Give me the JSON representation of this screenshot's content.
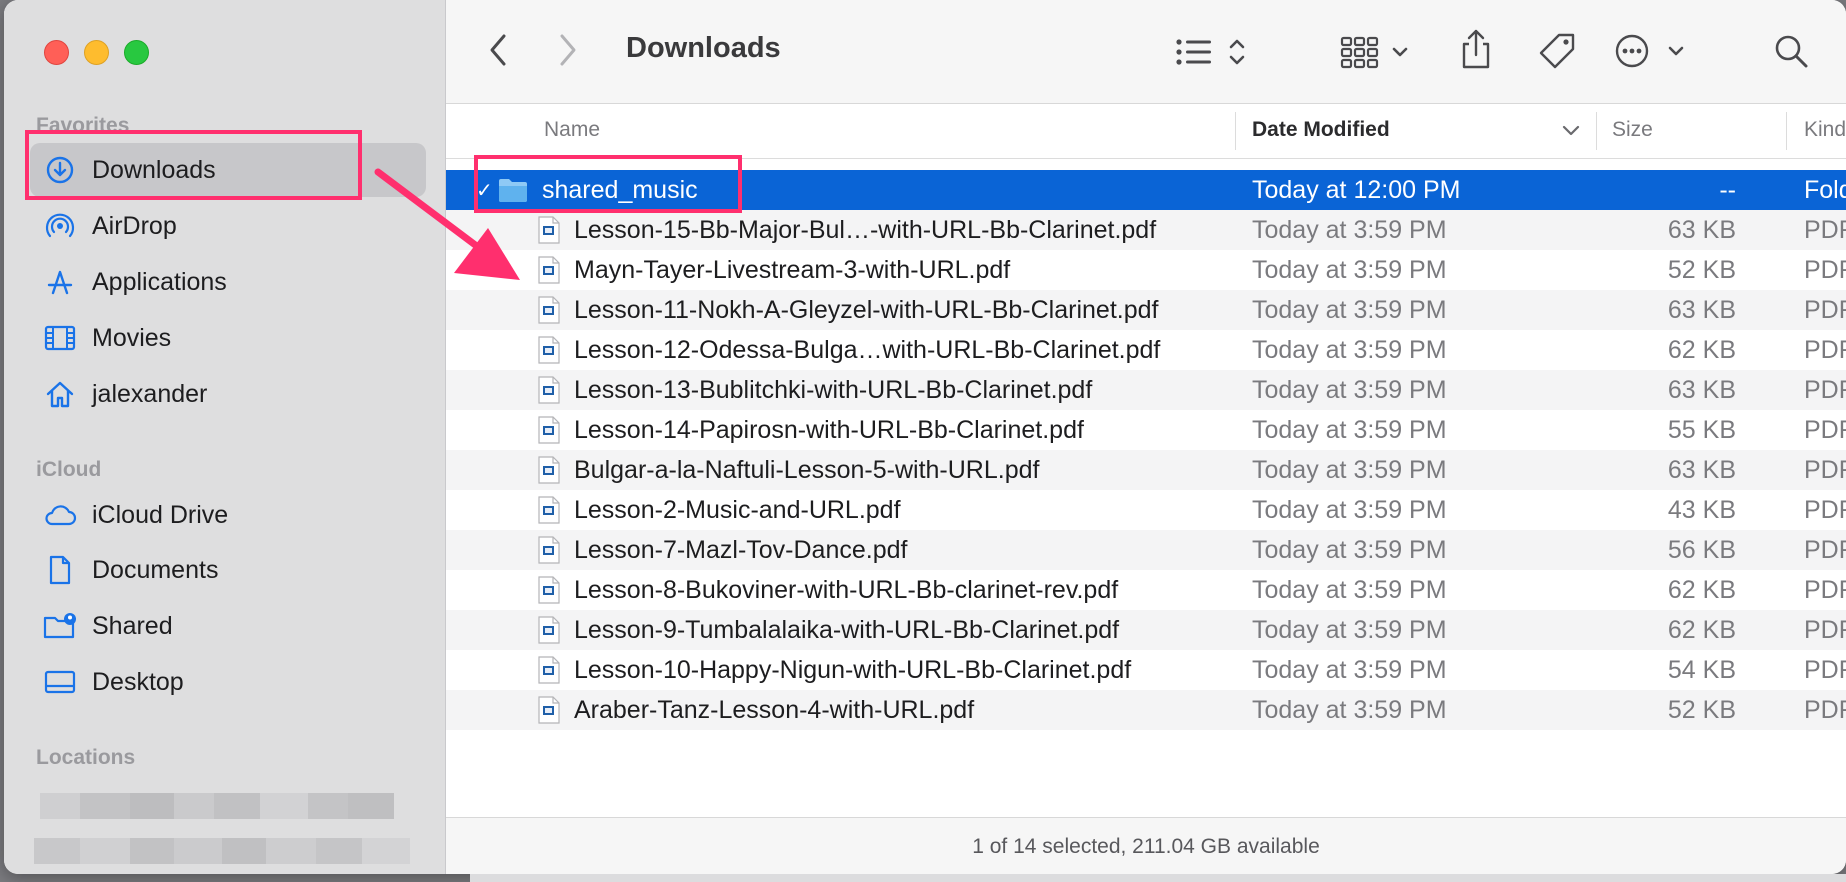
{
  "window": {
    "title": "Downloads"
  },
  "sidebar": {
    "sections": {
      "favorites": "Favorites",
      "icloud": "iCloud",
      "locations": "Locations"
    },
    "favorites": [
      {
        "label": "Downloads",
        "icon": "download-circle-icon"
      },
      {
        "label": "AirDrop",
        "icon": "airdrop-icon"
      },
      {
        "label": "Applications",
        "icon": "applications-icon"
      },
      {
        "label": "Movies",
        "icon": "film-icon"
      },
      {
        "label": "jalexander",
        "icon": "home-icon"
      }
    ],
    "icloud": [
      {
        "label": "iCloud Drive",
        "icon": "cloud-icon"
      },
      {
        "label": "Documents",
        "icon": "document-icon"
      },
      {
        "label": "Shared",
        "icon": "shared-folder-icon"
      },
      {
        "label": "Desktop",
        "icon": "desktop-icon"
      }
    ],
    "selected": "Downloads"
  },
  "toolbar": {
    "back": "back-chevron-icon",
    "forward": "forward-chevron-icon",
    "view_list": "list-view-icon",
    "group": "group-grid-icon",
    "share": "share-icon",
    "tags": "tag-icon",
    "more": "ellipsis-circle-icon",
    "search": "search-icon"
  },
  "columns": {
    "name": "Name",
    "date": "Date Modified",
    "size": "Size",
    "kind": "Kind"
  },
  "rows": [
    {
      "name": "shared_music",
      "date": "Today at 12:00 PM",
      "size": "--",
      "kind": "Folder",
      "type": "folder",
      "selected": true
    },
    {
      "name": "Lesson-15-Bb-Major-Bul…-with-URL-Bb-Clarinet.pdf",
      "date": "Today at 3:59 PM",
      "size": "63 KB",
      "kind": "PDF Document",
      "type": "pdf"
    },
    {
      "name": "Mayn-Tayer-Livestream-3-with-URL.pdf",
      "date": "Today at 3:59 PM",
      "size": "52 KB",
      "kind": "PDF Document",
      "type": "pdf"
    },
    {
      "name": "Lesson-11-Nokh-A-Gleyzel-with-URL-Bb-Clarinet.pdf",
      "date": "Today at 3:59 PM",
      "size": "63 KB",
      "kind": "PDF Document",
      "type": "pdf"
    },
    {
      "name": "Lesson-12-Odessa-Bulga…with-URL-Bb-Clarinet.pdf",
      "date": "Today at 3:59 PM",
      "size": "62 KB",
      "kind": "PDF Document",
      "type": "pdf"
    },
    {
      "name": "Lesson-13-Bublitchki-with-URL-Bb-Clarinet.pdf",
      "date": "Today at 3:59 PM",
      "size": "63 KB",
      "kind": "PDF Document",
      "type": "pdf"
    },
    {
      "name": "Lesson-14-Papirosn-with-URL-Bb-Clarinet.pdf",
      "date": "Today at 3:59 PM",
      "size": "55 KB",
      "kind": "PDF Document",
      "type": "pdf"
    },
    {
      "name": "Bulgar-a-la-Naftuli-Lesson-5-with-URL.pdf",
      "date": "Today at 3:59 PM",
      "size": "63 KB",
      "kind": "PDF Document",
      "type": "pdf"
    },
    {
      "name": "Lesson-2-Music-and-URL.pdf",
      "date": "Today at 3:59 PM",
      "size": "43 KB",
      "kind": "PDF Document",
      "type": "pdf"
    },
    {
      "name": "Lesson-7-Mazl-Tov-Dance.pdf",
      "date": "Today at 3:59 PM",
      "size": "56 KB",
      "kind": "PDF Document",
      "type": "pdf"
    },
    {
      "name": "Lesson-8-Bukoviner-with-URL-Bb-clarinet-rev.pdf",
      "date": "Today at 3:59 PM",
      "size": "62 KB",
      "kind": "PDF Document",
      "type": "pdf"
    },
    {
      "name": "Lesson-9-Tumbalalaika-with-URL-Bb-Clarinet.pdf",
      "date": "Today at 3:59 PM",
      "size": "62 KB",
      "kind": "PDF Document",
      "type": "pdf"
    },
    {
      "name": "Lesson-10-Happy-Nigun-with-URL-Bb-Clarinet.pdf",
      "date": "Today at 3:59 PM",
      "size": "54 KB",
      "kind": "PDF Document",
      "type": "pdf"
    },
    {
      "name": "Araber-Tanz-Lesson-4-with-URL.pdf",
      "date": "Today at 3:59 PM",
      "size": "52 KB",
      "kind": "PDF Document",
      "type": "pdf"
    }
  ],
  "status_bar": "1 of 14 selected, 211.04 GB available",
  "colors": {
    "selection": "#0a64d6",
    "accent_icon": "#1a73e8",
    "annotation": "#ff2f6e"
  }
}
